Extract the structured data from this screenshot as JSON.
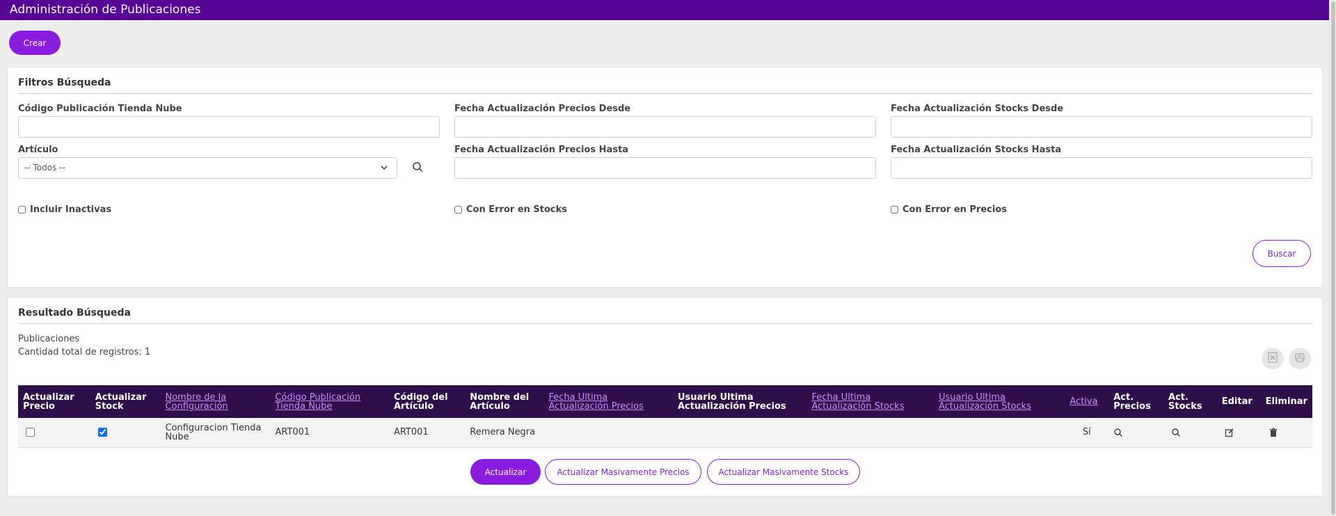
{
  "page_title": "Administración de Publicaciones",
  "create_button": "Crear",
  "filters": {
    "title": "Filtros Búsqueda",
    "codigo_label": "Código Publicación Tienda Nube",
    "precios_desde_label": "Fecha Actualización Precios Desde",
    "stocks_desde_label": "Fecha Actualización Stocks Desde",
    "articulo_label": "Artículo",
    "articulo_value": "-- Todos --",
    "precios_hasta_label": "Fecha Actualización Precios Hasta",
    "stocks_hasta_label": "Fecha Actualización Stocks Hasta",
    "incluir_inactivas": "Incluir Inactivas",
    "error_stocks": "Con Error en Stocks",
    "error_precios": "Con Error en Precios",
    "search_button": "Buscar"
  },
  "results": {
    "title": "Resultado Búsqueda",
    "subtitle": "Publicaciones",
    "count_text": "Cantidad total de registros: 1",
    "columns": [
      "Actualizar Precio",
      "Actualizar Stock",
      "Nombre de la Configuración",
      "Código Publicación Tienda Nube",
      "Código del Artículo",
      "Nombre del Artículo",
      "Fecha Ultima Actualización Precios",
      "Usuario Ultima Actualización Precios",
      "Fecha Ultima Actualización Stocks",
      "Usuario Ultima Actualización Stocks",
      "Activa",
      "Act. Precios",
      "Act. Stocks",
      "Editar",
      "Eliminar"
    ],
    "rows": [
      {
        "actualizar_precio": false,
        "actualizar_stock": true,
        "configuracion": "Configuracion Tienda Nube",
        "codigo_publicacion": "ART001",
        "codigo_articulo": "ART001",
        "nombre_articulo": "Remera Negra",
        "fecha_precios": "",
        "usuario_precios": "",
        "fecha_stocks": "",
        "usuario_stocks": "",
        "activa": "Sí"
      }
    ]
  },
  "footer_buttons": {
    "actualizar": "Actualizar",
    "masivo_precios": "Actualizar Masivamente Precios",
    "masivo_stocks": "Actualizar Masivamente Stocks"
  },
  "colors": {
    "header_bar": "#560596",
    "accent": "#8a1ce0",
    "table_header": "#2f0f4a",
    "table_link": "#c78cff"
  },
  "icons": [
    "search-icon",
    "chevron-down-icon",
    "excel-export-icon",
    "pdf-export-icon",
    "edit-icon",
    "trash-icon"
  ]
}
